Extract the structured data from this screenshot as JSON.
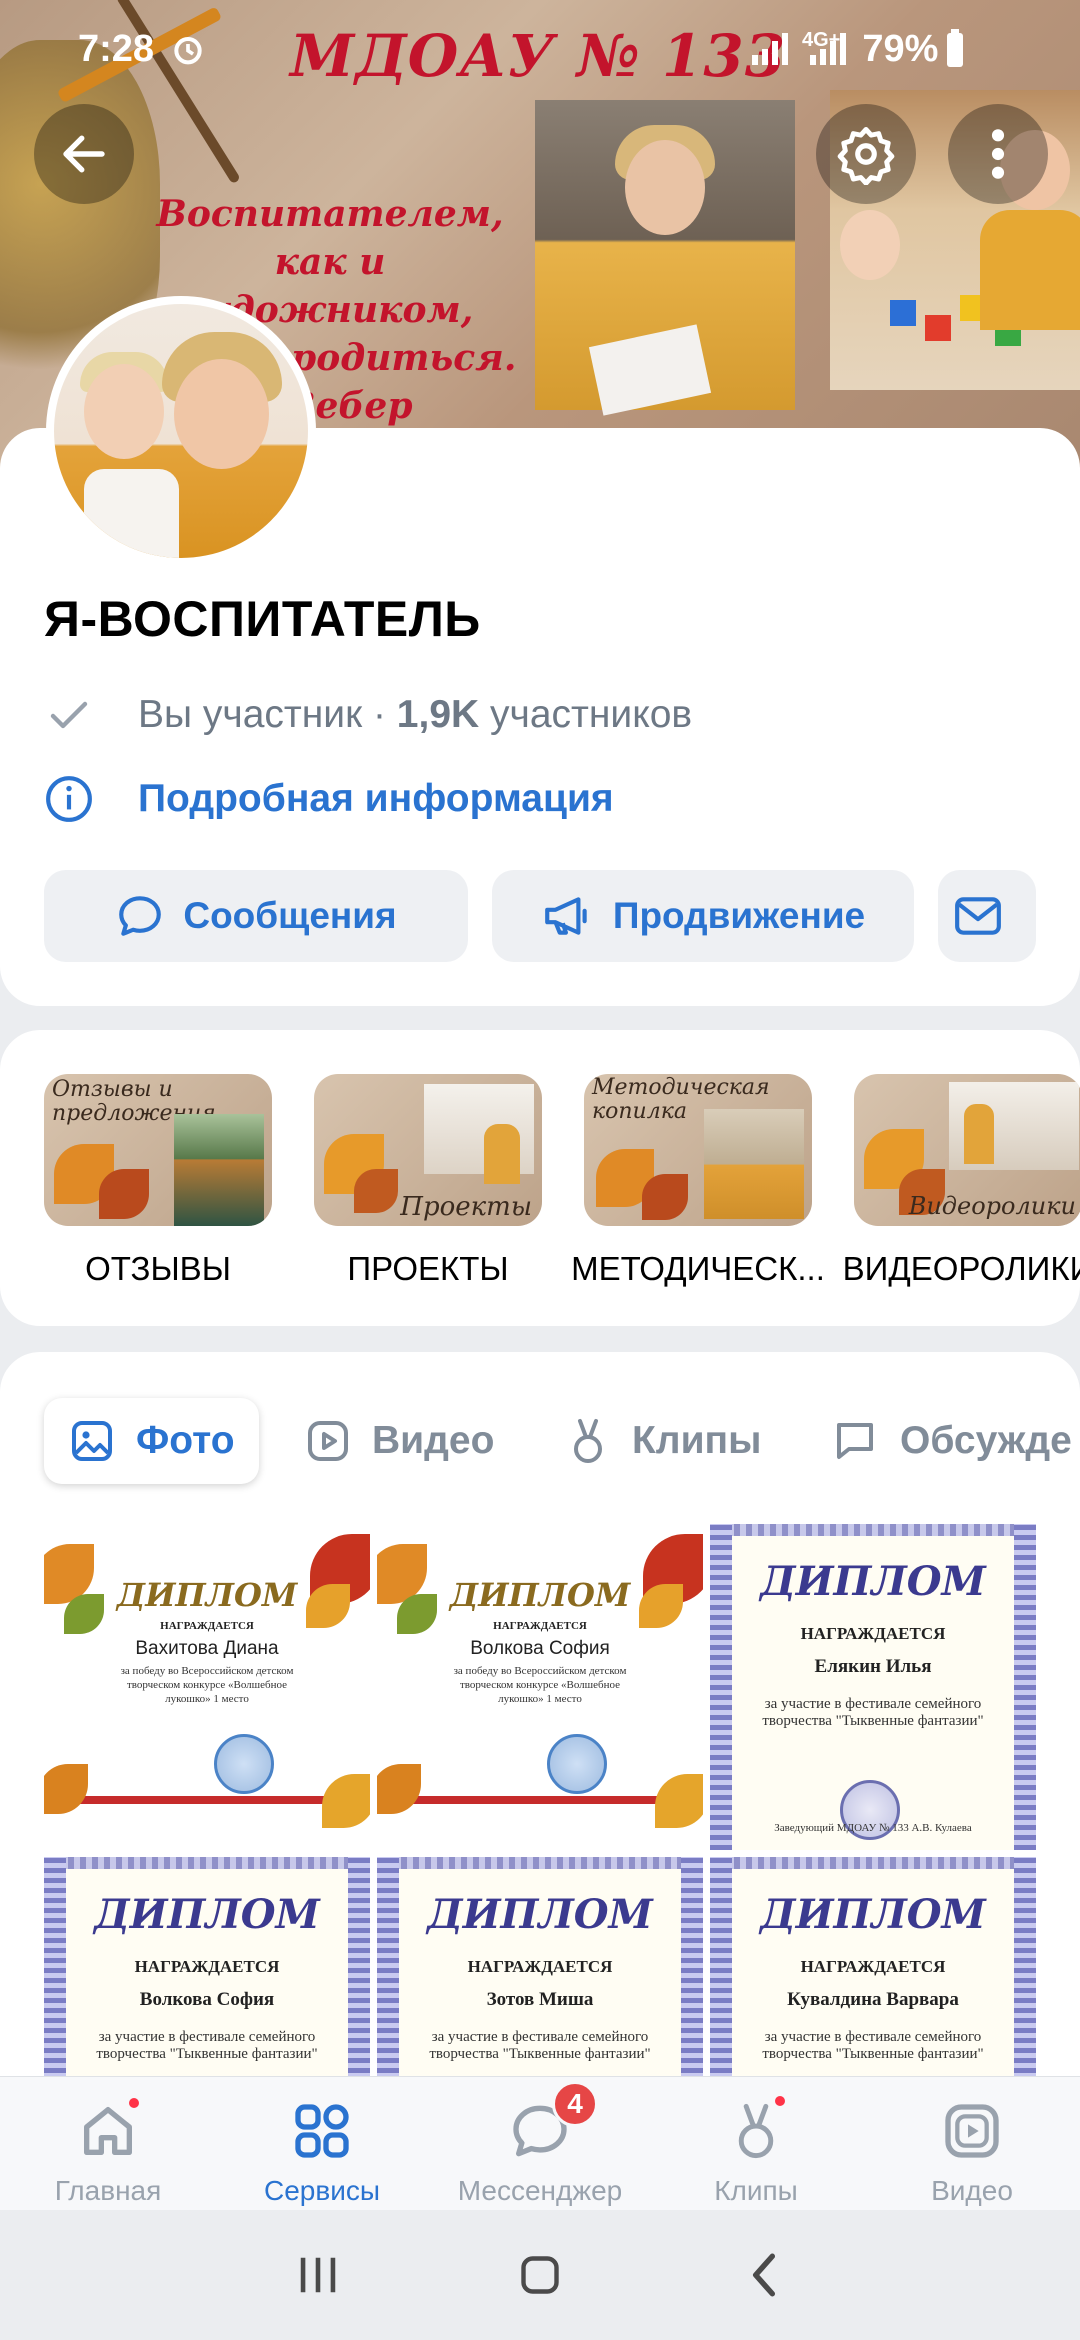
{
  "status_bar": {
    "time": "7:28",
    "network": "4G+",
    "battery": "79%"
  },
  "cover": {
    "title": "МДОАУ № 133",
    "quote_lines": [
      "Воспитателем,",
      "как и художником,",
      "...жно родиться.",
      "...Вебер"
    ]
  },
  "group": {
    "name": "Я-ВОСПИТАТЕЛЬ",
    "member_status": "Вы участник · ",
    "member_count": "1,9K",
    "member_suffix": " участников",
    "info_link": "Подробная информация"
  },
  "actions": {
    "messages": "Сообщения",
    "promotion": "Продвижение"
  },
  "albums": [
    {
      "label": "ОТЗЫВЫ",
      "caption": "Отзывы и предложения"
    },
    {
      "label": "ПРОЕКТЫ",
      "caption": "Проекты"
    },
    {
      "label": "МЕТОДИЧЕСК...",
      "caption": "Методическая копилка"
    },
    {
      "label": "ВИДЕОРОЛИКИ",
      "caption": "Видеоролики"
    }
  ],
  "media_tabs": [
    "Фото",
    "Видео",
    "Клипы",
    "Обсужде"
  ],
  "photos": [
    {
      "head": "ДИПЛОМ",
      "sub": "НАГРАЖДАЕТСЯ",
      "name": "Вахитова Диана",
      "body": "за победу во Всероссийском детском творческом конкурсе «Волшебное лукошко» 1 место"
    },
    {
      "head": "ДИПЛОМ",
      "sub": "НАГРАЖДАЕТСЯ",
      "name": "Волкова София",
      "body": "за победу во Всероссийском детском творческом конкурсе «Волшебное лукошко» 1 место"
    },
    {
      "head": "ДИПЛОМ",
      "sub": "НАГРАЖДАЕТСЯ",
      "name": "Елякин Илья",
      "body": "за участие в фестивале семейного творчества \"Тыквенные фантазии\"",
      "footer": "Заведующий МДОАУ № 133 А.В. Кулаева"
    },
    {
      "head": "ДИПЛОМ",
      "sub": "НАГРАЖДАЕТСЯ",
      "name": "Волкова София",
      "body": "за участие в фестивале семейного творчества \"Тыквенные фантазии\""
    },
    {
      "head": "ДИПЛОМ",
      "sub": "НАГРАЖДАЕТСЯ",
      "name": "Зотов Миша",
      "body": "за участие в фестивале семейного творчества \"Тыквенные фантазии\""
    },
    {
      "head": "ДИПЛОМ",
      "sub": "НАГРАЖДАЕТСЯ",
      "name": "Кувалдина Варвара",
      "body": "за участие в фестивале семейного творчества \"Тыквенные фантазии\""
    }
  ],
  "bottom_nav": [
    {
      "label": "Главная",
      "icon": "home-icon"
    },
    {
      "label": "Сервисы",
      "icon": "services-icon"
    },
    {
      "label": "Мессенджер",
      "icon": "messenger-icon",
      "badge": "4"
    },
    {
      "label": "Клипы",
      "icon": "clips-icon"
    },
    {
      "label": "Видео",
      "icon": "video-icon"
    }
  ],
  "colors": {
    "accent": "#2a73d0",
    "badge": "#e64646",
    "title_red": "#c3142c"
  }
}
